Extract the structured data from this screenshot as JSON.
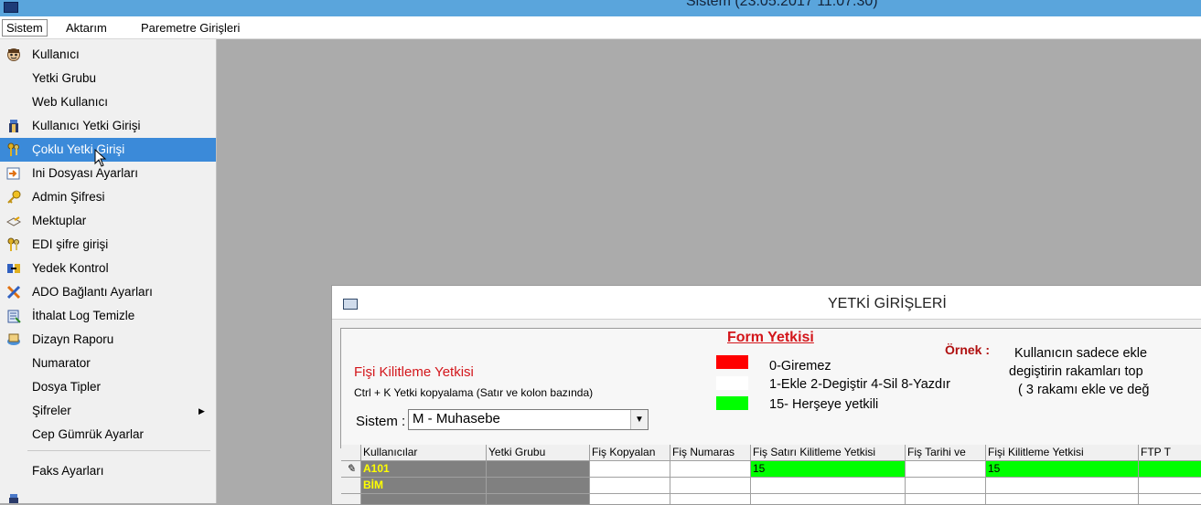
{
  "window": {
    "title": "Sistem (23.05.2017  11:07:30)"
  },
  "menubar": {
    "items": [
      "Sistem",
      "Aktarım",
      "Paremetre Girişleri"
    ]
  },
  "dropdown": {
    "items": [
      {
        "label": "Kullanıcı",
        "icon": "user-face-icon"
      },
      {
        "label": "Yetki Grubu",
        "icon": ""
      },
      {
        "label": "Web Kullanıcı",
        "icon": ""
      },
      {
        "label": "Kullanıcı Yetki Girişi",
        "icon": "user-permission-icon"
      },
      {
        "label": "Çoklu Yetki Girişi",
        "icon": "keys-icon"
      },
      {
        "label": "Ini Dosyası Ayarları",
        "icon": "ini-file-icon"
      },
      {
        "label": "Admin Şifresi",
        "icon": "key-icon"
      },
      {
        "label": "Mektuplar",
        "icon": "letter-icon"
      },
      {
        "label": "EDI şifre girişi",
        "icon": "keys-icon"
      },
      {
        "label": "Yedek Kontrol",
        "icon": "backup-icon"
      },
      {
        "label": "ADO Bağlantı Ayarları",
        "icon": "connection-icon"
      },
      {
        "label": "İthalat Log Temizle",
        "icon": "clean-log-icon"
      },
      {
        "label": "Dizayn Raporu",
        "icon": "report-design-icon"
      },
      {
        "label": "Numarator",
        "icon": ""
      },
      {
        "label": "Dosya Tipler",
        "icon": ""
      },
      {
        "label": "Şifreler",
        "icon": ""
      },
      {
        "label": "Cep Gümrük Ayarlar",
        "icon": ""
      },
      {
        "label": "Faks Ayarları",
        "icon": ""
      }
    ],
    "highlighted_index": 4
  },
  "dialog": {
    "title": "YETKİ GİRİŞLERİ",
    "lock_title": "Fişi Kilitleme Yetkisi",
    "copy_hint": "Ctrl + K Yetki kopyalama (Satır ve kolon bazında)",
    "system_label": "Sistem :",
    "system_value": "M - Muhasebe",
    "form_title": "Form Yetkisi",
    "legend": [
      {
        "text": "0-Giremez",
        "color": "#ff0000"
      },
      {
        "text": "1-Ekle  2-Degiştir  4-Sil  8-Yazdır",
        "color": "#ffffff"
      },
      {
        "text": "15- Herşeye yetkili",
        "color": "#00ff00"
      }
    ],
    "example_label": "Örnek :",
    "example_lines": [
      "Kullanıcın sadece ekle",
      "degiştirin rakamları top",
      "( 3 rakamı ekle ve değ"
    ]
  },
  "grid": {
    "columns": [
      "Kullanıcılar",
      "Yetki Grubu",
      "Fiş Kopyalan",
      "Fiş Numaras",
      "Fiş Satırı Kilitleme Yetkisi",
      "Fiş Tarihi ve",
      "Fişi Kilitleme Yetkisi",
      "FTP T"
    ],
    "rows": [
      [
        "A101",
        "",
        "",
        "",
        "15",
        "",
        "15",
        ""
      ],
      [
        "BİM",
        "",
        "",
        "",
        "",
        "",
        "",
        ""
      ],
      [
        "",
        "",
        "",
        "",
        "",
        "",
        "",
        ""
      ]
    ],
    "green_cell_color": "#00ff00"
  }
}
